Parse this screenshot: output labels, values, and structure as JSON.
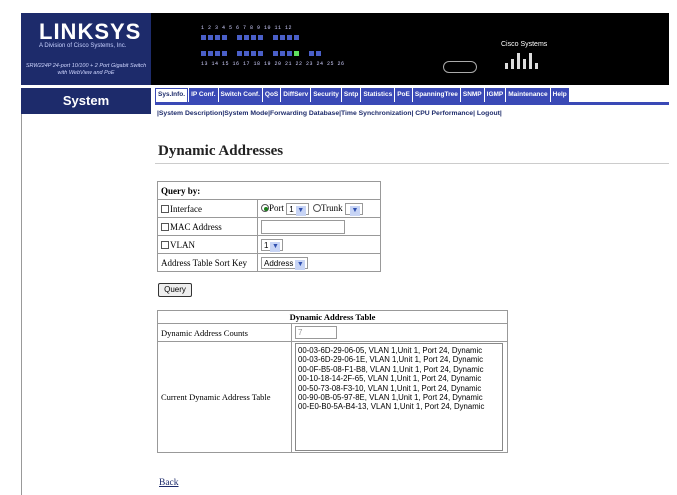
{
  "header": {
    "brand": "LINKSYS",
    "brand_sub": "A Division of Cisco Systems, Inc.",
    "model": "SRW224P 24-port 10/100 + 2 Port Gigabit Switch with WebView and PoE",
    "port_labels_top": "1 2 3 4   5 6 7 8   9 10 11 12",
    "port_labels_bottom": "13 14 15 16   17 18 19 20   21 22 23 24   25 26",
    "cisco": "Cisco Systems",
    "colors": {
      "header_bg": "#000000",
      "brand_bg": "#1d2b6b",
      "tab_bg": "#3a49b6",
      "led_on": "#5fe05f"
    }
  },
  "sidebar": {
    "title": "System"
  },
  "tabs": [
    {
      "label": "Sys.Info.",
      "active": true
    },
    {
      "label": "IP Conf."
    },
    {
      "label": "Switch Conf."
    },
    {
      "label": "QoS"
    },
    {
      "label": "DiffServ"
    },
    {
      "label": "Security"
    },
    {
      "label": "Sntp"
    },
    {
      "label": "Statistics"
    },
    {
      "label": "PoE"
    },
    {
      "label": "SpanningTree"
    },
    {
      "label": "SNMP"
    },
    {
      "label": "IGMP"
    },
    {
      "label": "Maintenance"
    },
    {
      "label": "Help"
    }
  ],
  "subnav": "|System Description|System Mode|Forwarding Database|Time Synchronization| CPU Performance| Logout|",
  "page_title": "Dynamic Addresses",
  "query": {
    "heading": "Query by:",
    "interface_label": "Interface",
    "port_label": "Port",
    "port_value": "1",
    "trunk_label": "Trunk",
    "trunk_value": "",
    "mac_label": "MAC Address",
    "vlan_label": "VLAN",
    "vlan_value": "1",
    "sort_label": "Address Table Sort Key",
    "sort_value": "Address",
    "button": "Query"
  },
  "results": {
    "title": "Dynamic Address Table",
    "count_label": "Dynamic Address Counts",
    "count_value": "7",
    "current_label": "Current Dynamic Address Table",
    "entries": [
      "00-03-6D-29-06-05, VLAN 1,Unit 1, Port 24, Dynamic",
      "00-03-6D-29-06-1E, VLAN 1,Unit 1, Port 24, Dynamic",
      "00-0F-B5-08-F1-B8, VLAN 1,Unit 1, Port 24, Dynamic",
      "00-10-18-14-2F-65, VLAN 1,Unit 1, Port 24, Dynamic",
      "00-50-73-08-F3-10, VLAN 1,Unit 1, Port 24, Dynamic",
      "00-90-0B-05-97-8E, VLAN 1,Unit 1, Port 24, Dynamic",
      "00-E0-B0-5A-B4-13, VLAN 1,Unit 1, Port 24, Dynamic"
    ]
  },
  "back_label": "Back"
}
